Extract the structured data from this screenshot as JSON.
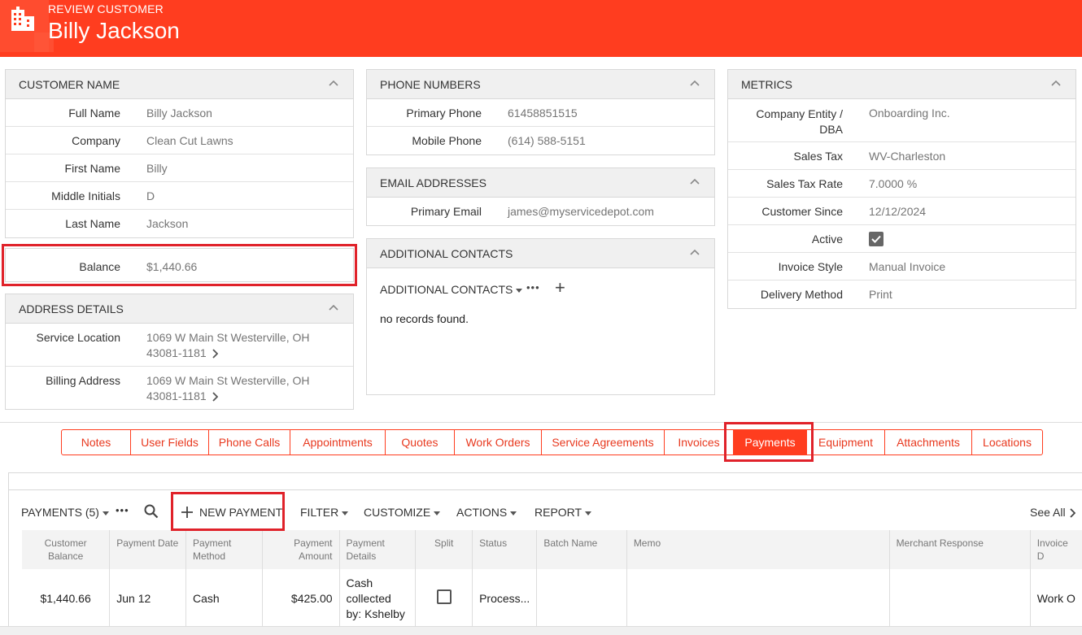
{
  "header": {
    "subtitle": "REVIEW CUSTOMER",
    "title": "Billy Jackson"
  },
  "customer_name": {
    "title": "CUSTOMER NAME",
    "rows": [
      {
        "label": "Full Name",
        "value": "Billy Jackson"
      },
      {
        "label": "Company",
        "value": "Clean Cut Lawns"
      },
      {
        "label": "First Name",
        "value": "Billy"
      },
      {
        "label": "Middle Initials",
        "value": "D"
      },
      {
        "label": "Last Name",
        "value": "Jackson"
      }
    ]
  },
  "balance": {
    "label": "Balance",
    "value": "$1,440.66"
  },
  "address": {
    "title": "ADDRESS DETAILS",
    "rows": [
      {
        "label": "Service Location",
        "line1": "1069 W Main St Westerville, OH",
        "line2": "43081-1181"
      },
      {
        "label": "Billing Address",
        "line1": "1069 W Main St Westerville, OH",
        "line2": "43081-1181"
      }
    ]
  },
  "phones": {
    "title": "PHONE NUMBERS",
    "rows": [
      {
        "label": "Primary Phone",
        "value": "61458851515"
      },
      {
        "label": "Mobile Phone",
        "value": "(614) 588-5151"
      }
    ]
  },
  "emails": {
    "title": "EMAIL ADDRESSES",
    "rows": [
      {
        "label": "Primary Email",
        "value": "james@myservicedepot.com"
      }
    ]
  },
  "contacts": {
    "title": "ADDITIONAL CONTACTS",
    "dropdown": "ADDITIONAL CONTACTS",
    "more": "•••",
    "add": "+",
    "empty": "no records found."
  },
  "metrics": {
    "title": "METRICS",
    "rows": [
      {
        "label": "Company Entity /",
        "label2": "DBA",
        "value": "Onboarding Inc."
      },
      {
        "label": "Sales Tax",
        "value": "WV-Charleston"
      },
      {
        "label": "Sales Tax Rate",
        "value": "7.0000 %"
      },
      {
        "label": "Customer Since",
        "value": "12/12/2024"
      },
      {
        "label": "Active",
        "checked": true
      },
      {
        "label": "Invoice Style",
        "value": "Manual Invoice"
      },
      {
        "label": "Delivery Method",
        "value": "Print"
      }
    ]
  },
  "tabs": [
    "Notes",
    "User Fields",
    "Phone Calls",
    "Appointments",
    "Quotes",
    "Work Orders",
    "Service Agreements",
    "Invoices",
    "Payments",
    "Equipment",
    "Attachments",
    "Locations"
  ],
  "active_tab": "Payments",
  "payments": {
    "title": "PAYMENTS (5)",
    "more": "•••",
    "new_payment": "NEW PAYMENT",
    "filter": "FILTER",
    "customize": "CUSTOMIZE",
    "actions": "ACTIONS",
    "report": "REPORT",
    "see_all": "See All",
    "columns": [
      "Customer Balance",
      "Payment Date",
      "Payment Method",
      "Payment Amount",
      "Payment Details",
      "Split",
      "Status",
      "Batch Name",
      "Memo",
      "Merchant Response",
      "Invoice D"
    ],
    "rows": [
      {
        "customer_balance": "$1,440.66",
        "payment_date": "Jun 12",
        "payment_method": "Cash",
        "payment_amount": "$425.00",
        "payment_details": "Cash collected by: Kshelby",
        "split": false,
        "status": "Process...",
        "batch_name": "",
        "memo": "",
        "merchant_response": "",
        "invoice": "Work O"
      }
    ]
  }
}
